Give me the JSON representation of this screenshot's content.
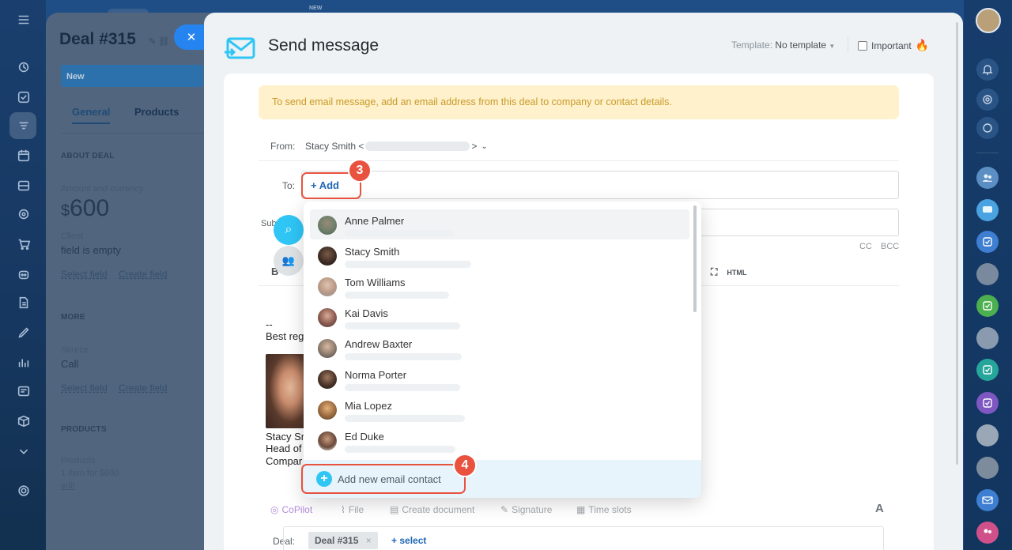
{
  "left_nav": {
    "icons": [
      "menu-icon",
      "activity-icon",
      "tasks-icon",
      "crm-icon",
      "calendar-icon",
      "drive-icon",
      "marketing-icon",
      "shop-icon",
      "robot-icon",
      "docs-icon",
      "sign-icon",
      "analytics-icon",
      "sites-icon",
      "box-icon",
      "chevron-down-icon",
      "settings-icon"
    ]
  },
  "top_badge": "NEW",
  "deal": {
    "title": "Deal #315",
    "stage": "New",
    "tabs": [
      "General",
      "Products"
    ],
    "about_heading": "ABOUT DEAL",
    "amount_label": "Amount and currency",
    "amount_currency": "$",
    "amount_value": "600",
    "client_label": "Client",
    "client_value": "field is empty",
    "select_field": "Select field",
    "create_field": "Create field",
    "more_heading": "MORE",
    "source_label": "Source",
    "source_value": "Call",
    "products_heading": "PRODUCTS",
    "products_label": "Products",
    "products_value": "1 item for $600",
    "products_edit": "edit"
  },
  "slider": {
    "title": "Send message",
    "template_label": "Template:",
    "template_value": "No template",
    "important_label": "Important",
    "alert_text": "To send email message, add an email address from this deal to company or contact details.",
    "from_label": "From:",
    "from_value_prefix": "Stacy Smith <",
    "from_value_suffix": ">",
    "to_label": "To:",
    "add_label": "+ Add",
    "subject_label_partial": "Sub",
    "cc_label": "CC",
    "bcc_label": "BCC",
    "editor_b": "B",
    "editor_html": "HTML",
    "signature_dashes": "--",
    "signature_best": "Best reg",
    "signature_name": "Stacy Sm",
    "signature_role": "Head of",
    "signature_company": "Compar",
    "toolbar": {
      "copilot": "CoPilot",
      "file": "File",
      "create_document": "Create document",
      "signature": "Signature",
      "time_slots": "Time slots",
      "font_toggle": "A"
    },
    "deal_label": "Deal:",
    "deal_chip": "Deal #315",
    "select_label": "+ select"
  },
  "dropdown": {
    "contacts": [
      {
        "name": "Anne Palmer"
      },
      {
        "name": "Stacy Smith"
      },
      {
        "name": "Tom Williams"
      },
      {
        "name": "Kai Davis"
      },
      {
        "name": "Andrew Baxter"
      },
      {
        "name": "Norma Porter"
      },
      {
        "name": "Mia Lopez"
      },
      {
        "name": "Ed Duke"
      }
    ],
    "add_new_label": "Add new email contact"
  },
  "steps": {
    "add": "3",
    "add_new": "4"
  },
  "colors": {
    "accent": "#2684f1",
    "highlight": "#e8523f",
    "alert_bg": "#fff1cc",
    "alert_text": "#c89a27",
    "add_icon": "#2fc6f6"
  }
}
